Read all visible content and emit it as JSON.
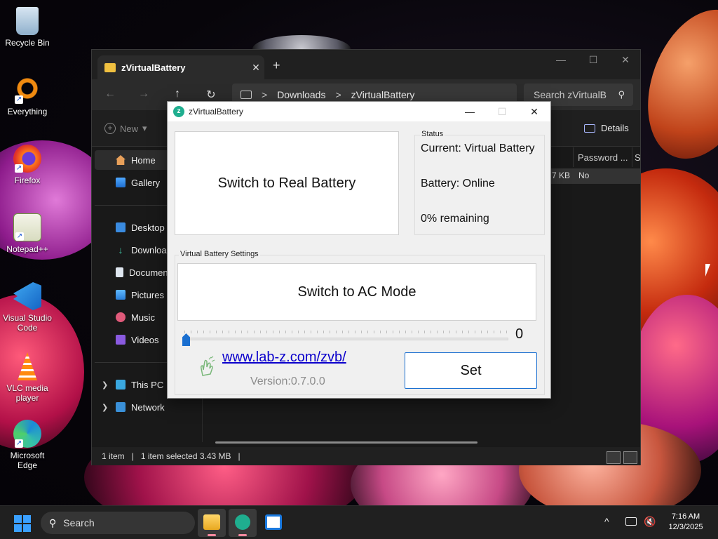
{
  "desktop": {
    "icons": [
      {
        "label": "Recycle Bin"
      },
      {
        "label": "Everything"
      },
      {
        "label": "Firefox"
      },
      {
        "label": "Notepad++"
      },
      {
        "label": "Visual Studio Code"
      },
      {
        "label": "VLC media player"
      },
      {
        "label": "Microsoft Edge"
      }
    ]
  },
  "explorer": {
    "tab_title": "zVirtualBattery",
    "tab_close": "✕",
    "new_tab": "+",
    "controls": {
      "minimize": "—",
      "maximize": "☐",
      "close": "✕"
    },
    "nav": {
      "back": "←",
      "forward": "→",
      "up": "↑",
      "refresh": "↻"
    },
    "breadcrumb": [
      "Downloads",
      "zVirtualBattery"
    ],
    "breadcrumb_sep": ">",
    "search_placeholder": "Search zVirtualB",
    "new_label": "New",
    "details_label": "Details",
    "sidebar": {
      "home": "Home",
      "gallery": "Gallery",
      "desktop": "Desktop",
      "downloads": "Downloads",
      "documents": "Documents",
      "pictures": "Pictures",
      "music": "Music",
      "videos": "Videos",
      "this_pc": "This PC",
      "network": "Network"
    },
    "columns": {
      "password": "Password ...",
      "size": "Si"
    },
    "row": {
      "size": "7 KB",
      "password": "No"
    },
    "status": {
      "items": "1 item",
      "selected": "1 item selected  3.43 MB",
      "sep": "|"
    }
  },
  "zvb": {
    "title": "zVirtualBattery",
    "logo": "z",
    "controls": {
      "minimize": "—",
      "maximize": "☐",
      "close": "✕"
    },
    "switch_real_label": "Switch to Real Battery",
    "status": {
      "legend": "Status",
      "current": "Current: Virtual Battery",
      "battery": "Battery: Online",
      "remaining": "0% remaining"
    },
    "settings": {
      "legend": "Virtual Battery Settings",
      "switch_ac_label": "Switch to AC Mode",
      "slider_value": "0",
      "slider_level": 0
    },
    "link": "www.lab-z.com/zvb/",
    "version": "Version:0.7.0.0",
    "set_label": "Set"
  },
  "taskbar": {
    "search_placeholder": "Search",
    "tray_chevron": "^",
    "time": "7:16 AM",
    "date": "12/3/2025"
  },
  "colors": {
    "accent": "#1a6fd0",
    "link": "#0b00cc",
    "zvb_logo": "#1fae8f",
    "folder": "#f0c040"
  }
}
